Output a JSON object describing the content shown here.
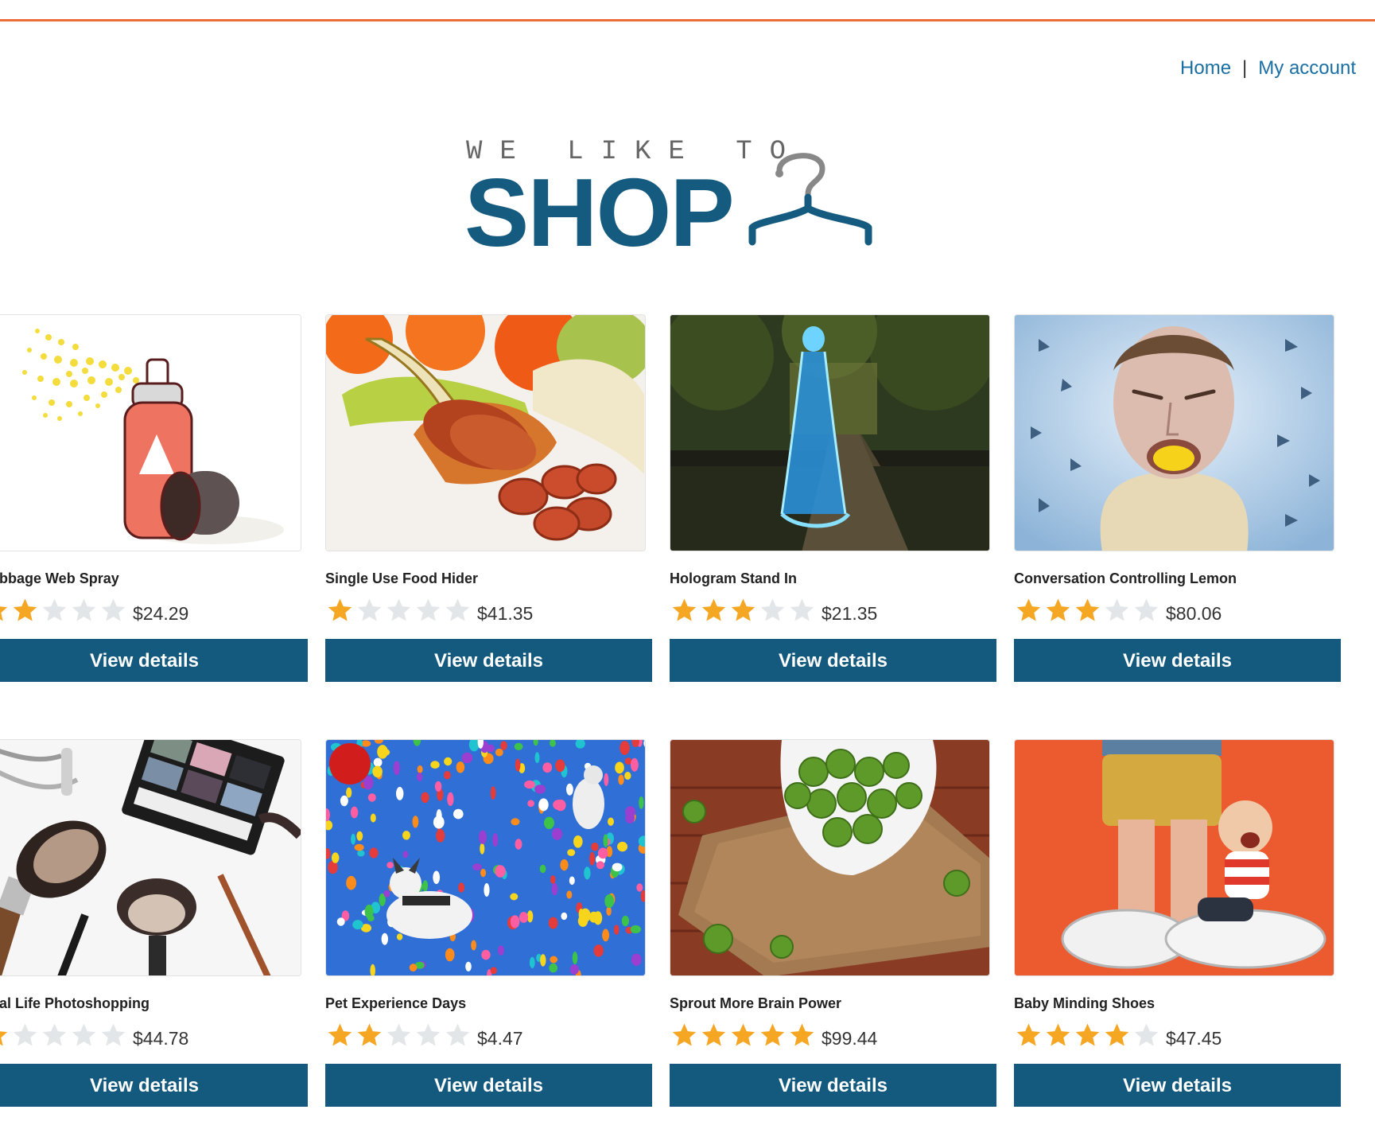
{
  "nav": {
    "home": "Home",
    "separator": "|",
    "account": "My account"
  },
  "logo": {
    "tagline": "WE LIKE TO",
    "wordmark": "SHOP"
  },
  "colors": {
    "accent_bar": "#ef6c3d",
    "brand": "#155b80",
    "button": "#135a7e",
    "link": "#1a6fa3",
    "star_on": "#f5a623",
    "star_off": "#e3e6e8"
  },
  "products": [
    {
      "name": "Babbage Web Spray",
      "rating": 2,
      "price": "$24.29",
      "button": "View details",
      "image": "spray-can-illustration"
    },
    {
      "name": "Single Use Food Hider",
      "rating": 1,
      "price": "$41.35",
      "button": "View details",
      "image": "sausage-in-banana-peel"
    },
    {
      "name": "Hologram Stand In",
      "rating": 3,
      "price": "$21.35",
      "button": "View details",
      "image": "hologram-woman-park"
    },
    {
      "name": "Conversation Controlling Lemon",
      "rating": 3,
      "price": "$80.06",
      "button": "View details",
      "image": "man-lemon-in-mouth"
    },
    {
      "name": "Real Life Photoshopping",
      "rating": 1,
      "price": "$44.78",
      "button": "View details",
      "image": "makeup-brushes-palette"
    },
    {
      "name": "Pet Experience Days",
      "rating": 2,
      "price": "$4.47",
      "button": "View details",
      "image": "dogs-balloons-sky"
    },
    {
      "name": "Sprout More Brain Power",
      "rating": 5,
      "price": "$99.44",
      "button": "View details",
      "image": "brussels-sprouts-bowl"
    },
    {
      "name": "Baby Minding Shoes",
      "rating": 4,
      "price": "$47.45",
      "button": "View details",
      "image": "figurine-child-clinging-leg"
    }
  ]
}
